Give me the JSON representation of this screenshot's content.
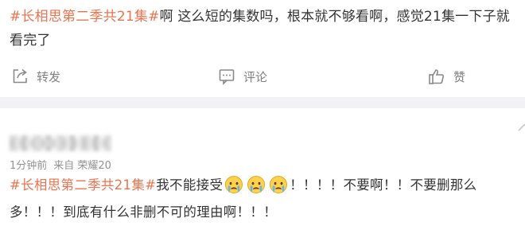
{
  "post": {
    "topic": "#长相思第二季共21集#",
    "text": "啊 这么短的集数吗，根本就不够看啊，感觉21集一下子就看完了"
  },
  "actions": {
    "repost": {
      "label": "转发",
      "icon": "share-icon"
    },
    "comment": {
      "label": "评论",
      "icon": "comment-icon"
    },
    "like": {
      "label": "赞",
      "icon": "thumbs-up-icon"
    }
  },
  "comment": {
    "time": "1分钟前",
    "source": "来自 荣耀20",
    "topic": "#长相思第二季共21集#",
    "text_before": "我不能接受",
    "emoji": "crying-face-emoji",
    "text_after": "！！！！不要啊！！不要删那么多！！！到底有什么非删不可的理由啊！！！"
  },
  "colors": {
    "topic": "#eb7350",
    "meta": "#939393",
    "divider": "#f2f2f5",
    "action_text": "#808080"
  }
}
